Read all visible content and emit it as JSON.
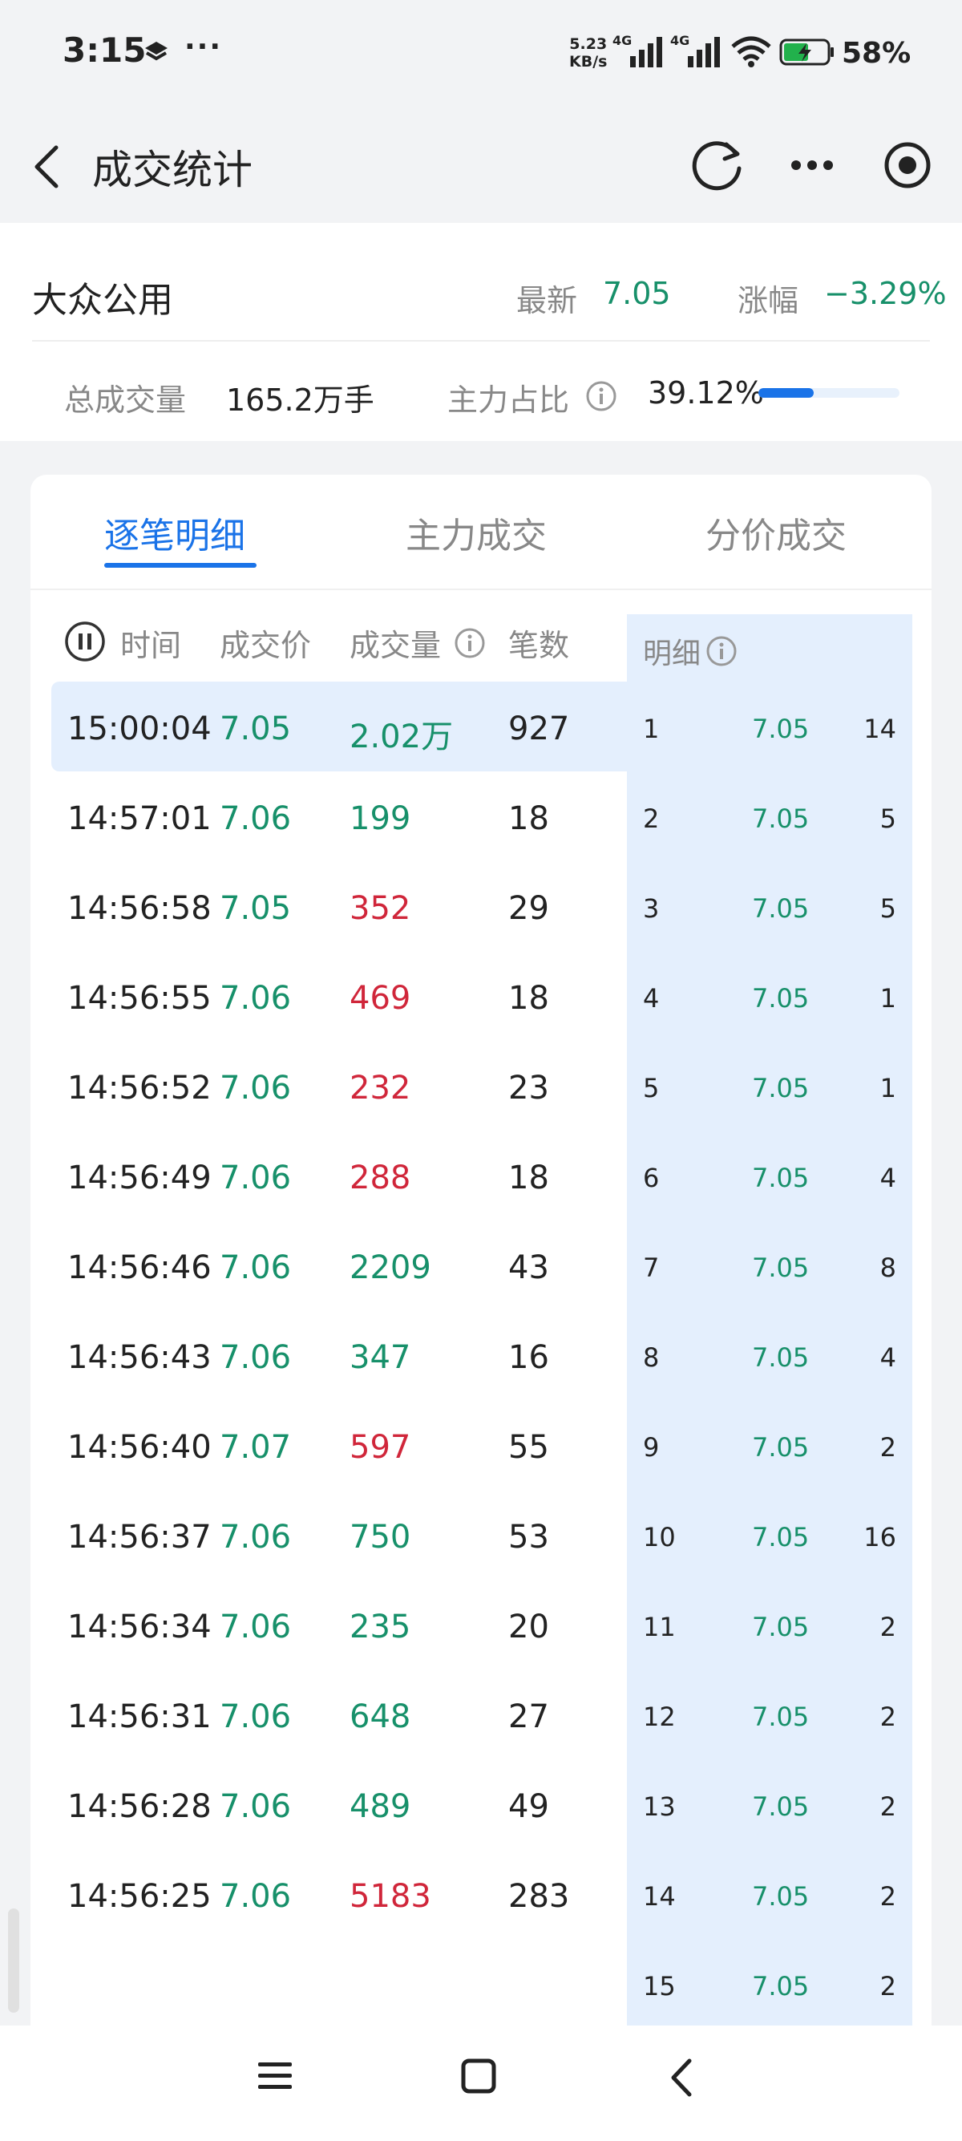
{
  "status_bar": {
    "time": "3:15",
    "speed_value": "5.23",
    "speed_unit": "KB/s",
    "network1": "4G",
    "network2": "4G",
    "battery": "58%"
  },
  "header": {
    "title": "成交统计"
  },
  "stock": {
    "name": "大众公用",
    "latest_label": "最新",
    "latest_value": "7.05",
    "change_label": "涨幅",
    "change_value": "−3.29%",
    "volume_label": "总成交量",
    "volume_value": "165.2万手",
    "main_ratio_label": "主力占比",
    "main_ratio_value": "39.12%",
    "main_ratio_fraction": 0.3912
  },
  "tabs": [
    {
      "label": "逐笔明细"
    },
    {
      "label": "主力成交"
    },
    {
      "label": "分价成交"
    }
  ],
  "table": {
    "headers": {
      "time": "时间",
      "price": "成交价",
      "volume": "成交量",
      "count": "笔数",
      "detail": "明细"
    },
    "rows": [
      {
        "time": "15:00:04",
        "price": "7.05",
        "price_color": "green",
        "volume": "2.02万",
        "volume_color": "green",
        "count": "927"
      },
      {
        "time": "14:57:01",
        "price": "7.06",
        "price_color": "green",
        "volume": "199",
        "volume_color": "green",
        "count": "18"
      },
      {
        "time": "14:56:58",
        "price": "7.05",
        "price_color": "green",
        "volume": "352",
        "volume_color": "red",
        "count": "29"
      },
      {
        "time": "14:56:55",
        "price": "7.06",
        "price_color": "green",
        "volume": "469",
        "volume_color": "red",
        "count": "18"
      },
      {
        "time": "14:56:52",
        "price": "7.06",
        "price_color": "green",
        "volume": "232",
        "volume_color": "red",
        "count": "23"
      },
      {
        "time": "14:56:49",
        "price": "7.06",
        "price_color": "green",
        "volume": "288",
        "volume_color": "red",
        "count": "18"
      },
      {
        "time": "14:56:46",
        "price": "7.06",
        "price_color": "green",
        "volume": "2209",
        "volume_color": "green",
        "count": "43"
      },
      {
        "time": "14:56:43",
        "price": "7.06",
        "price_color": "green",
        "volume": "347",
        "volume_color": "green",
        "count": "16"
      },
      {
        "time": "14:56:40",
        "price": "7.07",
        "price_color": "green",
        "volume": "597",
        "volume_color": "red",
        "count": "55"
      },
      {
        "time": "14:56:37",
        "price": "7.06",
        "price_color": "green",
        "volume": "750",
        "volume_color": "green",
        "count": "53"
      },
      {
        "time": "14:56:34",
        "price": "7.06",
        "price_color": "green",
        "volume": "235",
        "volume_color": "green",
        "count": "20"
      },
      {
        "time": "14:56:31",
        "price": "7.06",
        "price_color": "green",
        "volume": "648",
        "volume_color": "green",
        "count": "27"
      },
      {
        "time": "14:56:28",
        "price": "7.06",
        "price_color": "green",
        "volume": "489",
        "volume_color": "green",
        "count": "49"
      },
      {
        "time": "14:56:25",
        "price": "7.06",
        "price_color": "green",
        "volume": "5183",
        "volume_color": "red",
        "count": "283"
      }
    ],
    "detail_rows": [
      {
        "index": "1",
        "price": "7.05",
        "count": "14"
      },
      {
        "index": "2",
        "price": "7.05",
        "count": "5"
      },
      {
        "index": "3",
        "price": "7.05",
        "count": "5"
      },
      {
        "index": "4",
        "price": "7.05",
        "count": "1"
      },
      {
        "index": "5",
        "price": "7.05",
        "count": "1"
      },
      {
        "index": "6",
        "price": "7.05",
        "count": "4"
      },
      {
        "index": "7",
        "price": "7.05",
        "count": "8"
      },
      {
        "index": "8",
        "price": "7.05",
        "count": "4"
      },
      {
        "index": "9",
        "price": "7.05",
        "count": "2"
      },
      {
        "index": "10",
        "price": "7.05",
        "count": "16"
      },
      {
        "index": "11",
        "price": "7.05",
        "count": "2"
      },
      {
        "index": "12",
        "price": "7.05",
        "count": "2"
      },
      {
        "index": "13",
        "price": "7.05",
        "count": "2"
      },
      {
        "index": "14",
        "price": "7.05",
        "count": "2"
      },
      {
        "index": "15",
        "price": "7.05",
        "count": "2"
      }
    ]
  },
  "colors": {
    "up_red": "#d0263a",
    "down_green": "#17906a",
    "accent_blue": "#1a73e8",
    "detail_bg": "#e4effd"
  }
}
